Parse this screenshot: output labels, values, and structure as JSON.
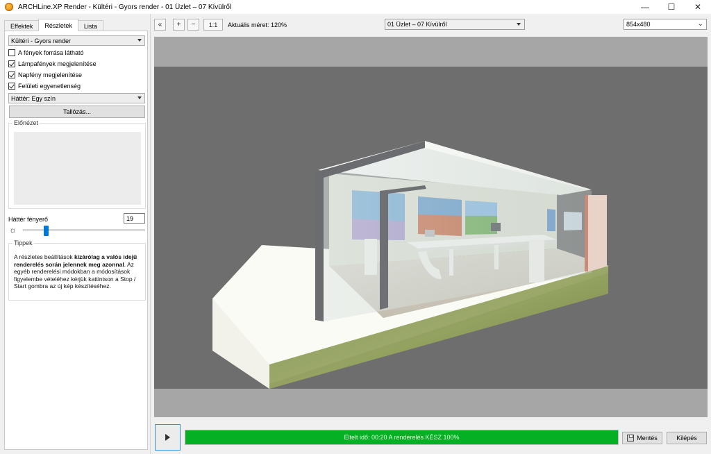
{
  "window": {
    "title": "ARCHLine.XP Render - Kültéri - Gyors render - 01 Üzlet – 07 Kívülről",
    "minimize": "—",
    "maximize": "☐",
    "close": "✕"
  },
  "tabs": [
    {
      "label": "Effektek",
      "active": false
    },
    {
      "label": "Részletek",
      "active": true
    },
    {
      "label": "Lista",
      "active": false
    }
  ],
  "details": {
    "preset": "Kültéri - Gyors render",
    "checkboxes": [
      {
        "label": "A fények forrása látható",
        "checked": false
      },
      {
        "label": "Lámpafények megjelenítése",
        "checked": true
      },
      {
        "label": "Napfény megjelenítése",
        "checked": true
      },
      {
        "label": "Felületi egyenetlenség",
        "checked": true
      }
    ],
    "background": "Háttér: Egy szín",
    "browse_label": "Tallózás...",
    "preview_label": "Előnézet",
    "brightness_label": "Háttér fényerő",
    "brightness_value": "19",
    "brightness_level": 0.19,
    "tips_label": "Tippek",
    "tips": {
      "t1": "A részletes beállítások ",
      "t2": "kizárólag a valós idejű renderelés során jelennek meg azonnal",
      "t3": ". Az egyéb renderelési módokban a módosítások figyelembe vételéhez kérjük kattintson a Stop / Start gombra az új kép készítéséhez."
    }
  },
  "toolbar": {
    "collapse_icon": "«",
    "zoom_in_icon": "+",
    "zoom_out_icon": "−",
    "one_to_one": "1:1",
    "current_size": "Aktuális méret: 120%",
    "view_select": "01 Üzlet – 07 Kívülről",
    "resolution_select": "854x480"
  },
  "bottom": {
    "progress_text": "Eltelt idő: 00:20  A renderelés KÉSZ  100%",
    "progress": 1.0,
    "save_label": "Mentés",
    "exit_label": "Kilépés"
  },
  "colors": {
    "progress": "#06b025",
    "accent": "#0078d7"
  }
}
